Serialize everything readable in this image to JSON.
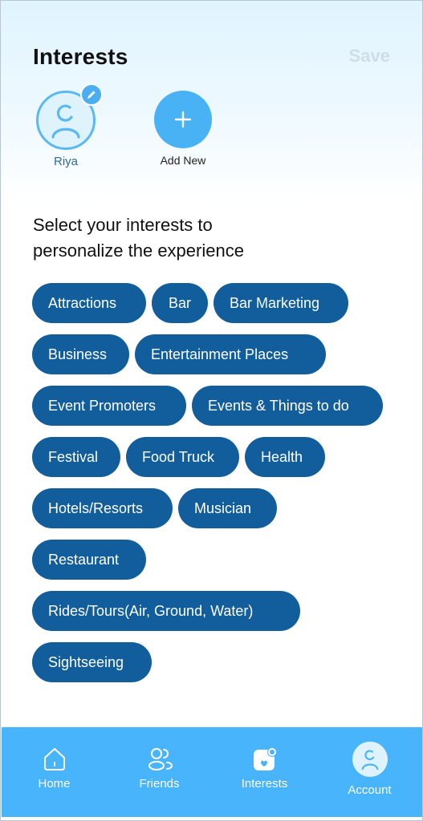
{
  "header": {
    "title": "Interests",
    "save_label": "Save"
  },
  "profiles": {
    "current": {
      "name": "Riya",
      "icon": "user-icon",
      "badge_icon": "pencil-icon"
    },
    "add_new": {
      "label": "Add New",
      "icon": "plus-icon"
    }
  },
  "prompt": {
    "line1": "Select your interests to",
    "line2": "personalize the experience"
  },
  "interests": [
    "Attractions",
    "Bar",
    "Bar Marketing",
    "Business",
    "Entertainment Places",
    "Event Promoters",
    "Events & Things to do",
    "Festival",
    "Food Truck",
    "Health",
    "Hotels/Resorts",
    "Musician",
    "Restaurant",
    "Rides/Tours(Air, Ground, Water)",
    "Sightseeing"
  ],
  "colors": {
    "chip_bg": "#125e9c",
    "accent": "#48b4fb",
    "save_disabled": "#cfdde8"
  },
  "bottom_nav": {
    "items": [
      {
        "label": "Home",
        "icon": "home-icon"
      },
      {
        "label": "Friends",
        "icon": "friends-icon"
      },
      {
        "label": "Interests",
        "icon": "interests-icon"
      },
      {
        "label": "Account",
        "icon": "account-icon",
        "active": true
      }
    ]
  }
}
